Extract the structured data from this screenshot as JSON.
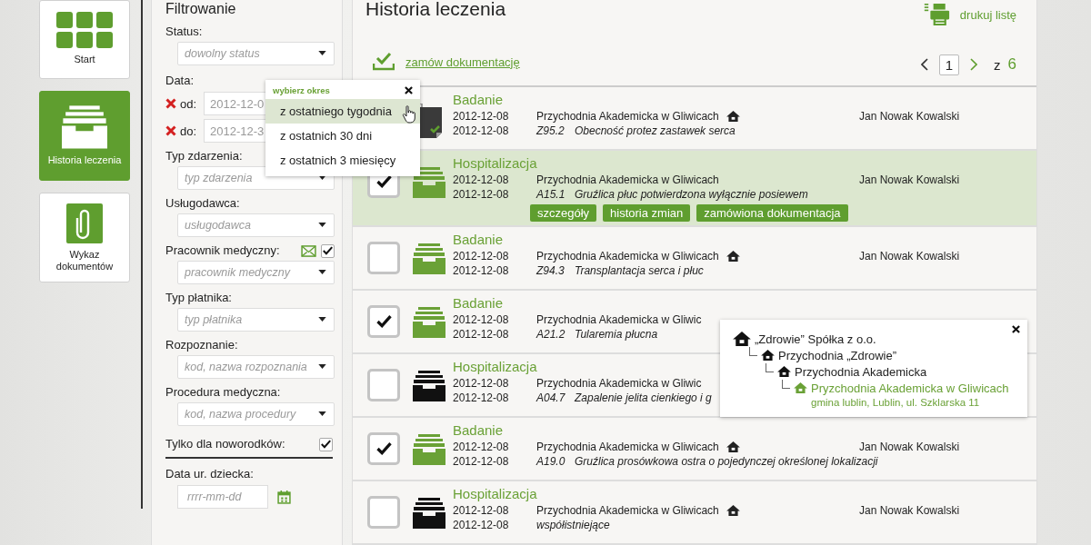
{
  "nav": [
    {
      "kind": "grid",
      "label": "Start",
      "selected": false
    },
    {
      "kind": "tray",
      "label": "Historia leczenia",
      "selected": true
    },
    {
      "kind": "paperclip",
      "label": "Wykaz dokumentów",
      "selected": false
    }
  ],
  "filter": {
    "title": "Filtrowanie",
    "fields": [
      {
        "kind": "select",
        "label": "Status:",
        "placeholder": "dowolny status"
      },
      {
        "kind": "daterange",
        "label": "Data:",
        "from_label": "od:",
        "from_value": "2012-12-0",
        "to_label": "do:",
        "to_value": "2012-12-3"
      },
      {
        "kind": "select",
        "label": "Typ zdarzenia:",
        "placeholder": "typ zdarzenia"
      },
      {
        "kind": "select",
        "label": "Usługodawca:",
        "placeholder": "usługodawca"
      },
      {
        "kind": "select",
        "label": "Pracownik medyczny:",
        "placeholder": "pracownik medyczny",
        "envelope": true,
        "checked": true
      },
      {
        "kind": "select",
        "label": "Typ płatnika:",
        "placeholder": "typ płatnika"
      },
      {
        "kind": "select",
        "label": "Rozpoznanie:",
        "placeholder": "kod, nazwa rozpoznania"
      },
      {
        "kind": "select",
        "label": "Procedura medyczna:",
        "placeholder": "kod, nazwa procedury"
      },
      {
        "kind": "checkbox",
        "label": "Tylko dla noworodków:",
        "checked": true
      },
      {
        "kind": "date",
        "label": "Data ur. dziecka:",
        "placeholder": "rrrr-mm-dd"
      }
    ]
  },
  "date_popup": {
    "title": "wybierz okres",
    "options": [
      {
        "label": "z ostatniego tygodnia",
        "selected": true
      },
      {
        "label": "z ostatnich 30 dni",
        "selected": false
      },
      {
        "label": "z ostatnich 3 miesięcy",
        "selected": false
      }
    ]
  },
  "main": {
    "title": "Historia leczenia",
    "print_label": "drukuj listę",
    "order_link": "zamów dokumentację",
    "pagination": {
      "page": "1",
      "of": "z",
      "total": "6"
    }
  },
  "rows": [
    {
      "kind": "document",
      "selected": false,
      "type": "Badanie",
      "date_1": "2012-12-08",
      "date_2": "2012-12-08",
      "clinic": "Przychodnia Akademicka w Gliwicach",
      "home": true,
      "person": "Jan Nowak Kowalski",
      "code": "Z95.2",
      "diagnosis": "Obecność protez zastawek serca"
    },
    {
      "kind": "tray",
      "color": "#6aa136",
      "checked": true,
      "selected": true,
      "type": "Hospitalizacja",
      "date_1": "2012-12-08",
      "date_2": "2012-12-08",
      "clinic": "Przychodnia Akademicka w Gliwicach",
      "home": false,
      "person": "Jan Nowak Kowalski",
      "code": "A15.1",
      "diagnosis": "Gruźlica płuc potwierdzona wyłącznie posiewem",
      "actions": [
        "szczegóły",
        "historia zmian",
        "zamówiona dokumentacja"
      ]
    },
    {
      "kind": "tray",
      "color": "#6aa136",
      "checked": false,
      "selected": false,
      "type": "Badanie",
      "date_1": "2012-12-08",
      "date_2": "2012-12-08",
      "clinic": "Przychodnia Akademicka w Gliwicach",
      "home": true,
      "person": "Jan Nowak Kowalski",
      "code": "Z94.3",
      "diagnosis": "Transplantacja serca i płuc"
    },
    {
      "kind": "tray",
      "color": "#6aa136",
      "checked": true,
      "selected": false,
      "type": "Badanie",
      "date_1": "2012-12-08",
      "date_2": "2012-12-08",
      "clinic": "Przychodnia Akademicka w Gliwic",
      "home": false,
      "code": "A21.2",
      "diagnosis": "Tularemia płucna"
    },
    {
      "kind": "tray",
      "color": "#111111",
      "checked": false,
      "selected": false,
      "type": "Hospitalizacja",
      "date_1": "2012-12-08",
      "date_2": "2012-12-08",
      "clinic": "Przychodnia Akademicka w Gliwic",
      "home": false,
      "code": "A04.7",
      "diagnosis": "Zapalenie jelita cienkiego i g"
    },
    {
      "kind": "tray",
      "color": "#6aa136",
      "checked": true,
      "selected": false,
      "type": "Badanie",
      "date_1": "2012-12-08",
      "date_2": "2012-12-08",
      "clinic": "Przychodnia Akademicka w Gliwicach",
      "home": true,
      "person": "Jan Nowak Kowalski",
      "code": "A19.0",
      "diagnosis": "Gruźlica prosówkowa ostra o pojedynczej określonej lokalizacji"
    },
    {
      "kind": "tray",
      "color": "#111111",
      "checked": false,
      "selected": false,
      "type": "Hospitalizacja",
      "date_1": "2012-12-08",
      "date_2": "2012-12-08",
      "clinic": "Przychodnia Akademicka w Gliwicach",
      "home": true,
      "person": "Jan Nowak Kowalski",
      "diagnosis": "współistniejące"
    }
  ],
  "org_popup": {
    "tree": [
      {
        "label": "„Zdrowie” Spółka z o.o.",
        "selected": false,
        "children": [
          {
            "label": "Przychodnia „Zdrowie”",
            "selected": false,
            "children": [
              {
                "label": "Przychodnia Akademicka",
                "selected": false,
                "children": [
                  {
                    "label": "Pryzchodnia Akademicka w Gliwicach",
                    "address": "gmina lublin, Lublin, ul. Szklarska 11",
                    "selected": true
                  }
                ]
              }
            ]
          }
        ]
      }
    ]
  }
}
